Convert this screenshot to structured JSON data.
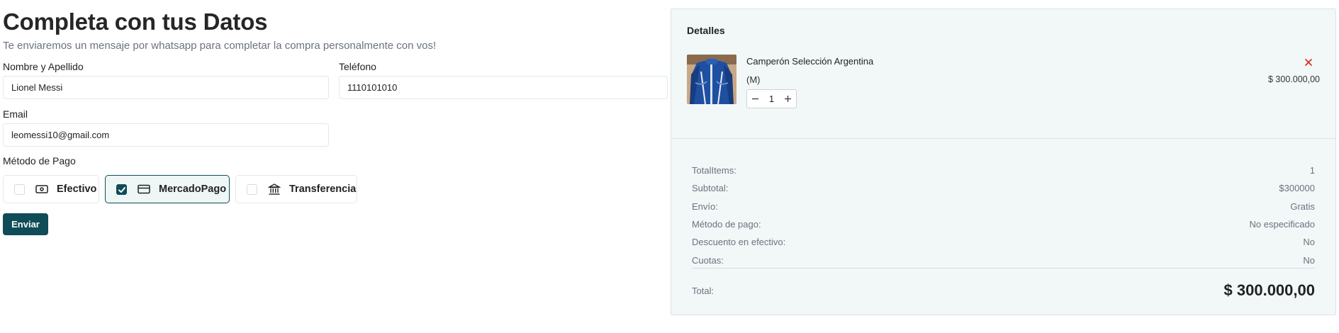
{
  "form": {
    "title": "Completa con tus Datos",
    "subtitle": "Te enviaremos un mensaje por whatsapp para completar la compra personalmente con vos!",
    "name_label": "Nombre y Apellido",
    "name_value": "Lionel Messi",
    "phone_label": "Teléfono",
    "phone_value": "1110101010",
    "email_label": "Email",
    "email_value": "leomessi10@gmail.com",
    "payment_label": "Método de Pago",
    "payment_methods": [
      {
        "label": "Efectivo",
        "icon": "banknote-icon",
        "checked": false
      },
      {
        "label": "MercadoPago",
        "icon": "credit-card-icon",
        "checked": true
      },
      {
        "label": "Transferencia",
        "icon": "bank-icon",
        "checked": false
      }
    ],
    "send_label": "Enviar"
  },
  "details": {
    "title": "Detalles",
    "item": {
      "name": "Camperón Selección Argentina",
      "size": "(M)",
      "price": "$ 300.000,00",
      "quantity": "1",
      "image": "jacket-image"
    },
    "summary": [
      {
        "label": "TotalItems:",
        "value": "1"
      },
      {
        "label": "Subtotal:",
        "value": "$300000"
      },
      {
        "label": "Envío:",
        "value": "Gratis"
      },
      {
        "label": "Método de pago:",
        "value": "No especificado"
      },
      {
        "label": "Descuento en efectivo:",
        "value": "No"
      },
      {
        "label": "Cuotas:",
        "value": "No"
      }
    ],
    "total_label": "Total:",
    "total_value": "$ 300.000,00"
  },
  "colors": {
    "primary": "#0f4c57",
    "panel_bg": "#f1f8f7",
    "remove": "#dc2626"
  }
}
